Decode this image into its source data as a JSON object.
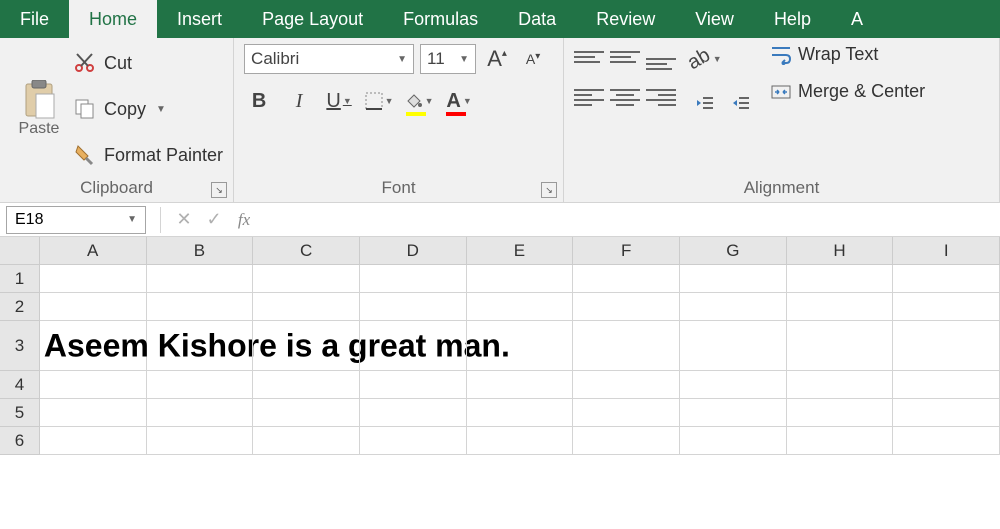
{
  "tabs": {
    "file": "File",
    "home": "Home",
    "insert": "Insert",
    "pageLayout": "Page Layout",
    "formulas": "Formulas",
    "data": "Data",
    "review": "Review",
    "view": "View",
    "help": "Help",
    "last": "A"
  },
  "clipboard": {
    "paste": "Paste",
    "cut": "Cut",
    "copy": "Copy",
    "formatPainter": "Format Painter",
    "label": "Clipboard"
  },
  "font": {
    "name": "Calibri",
    "size": "11",
    "bold": "B",
    "italic": "I",
    "underline": "U",
    "growA": "A",
    "shrinkA": "A",
    "fillA": "A",
    "fontColorA": "A",
    "label": "Font"
  },
  "alignment": {
    "wrapText": "Wrap Text",
    "mergeCenter": "Merge & Center",
    "label": "Alignment"
  },
  "formulaBar": {
    "nameBox": "E18",
    "fx": "fx",
    "formula": ""
  },
  "columns": [
    "A",
    "B",
    "C",
    "D",
    "E",
    "F",
    "G",
    "H",
    "I"
  ],
  "rows": [
    "1",
    "2",
    "3",
    "4",
    "5",
    "6"
  ],
  "cellA3": "Aseem Kishore is a great man."
}
